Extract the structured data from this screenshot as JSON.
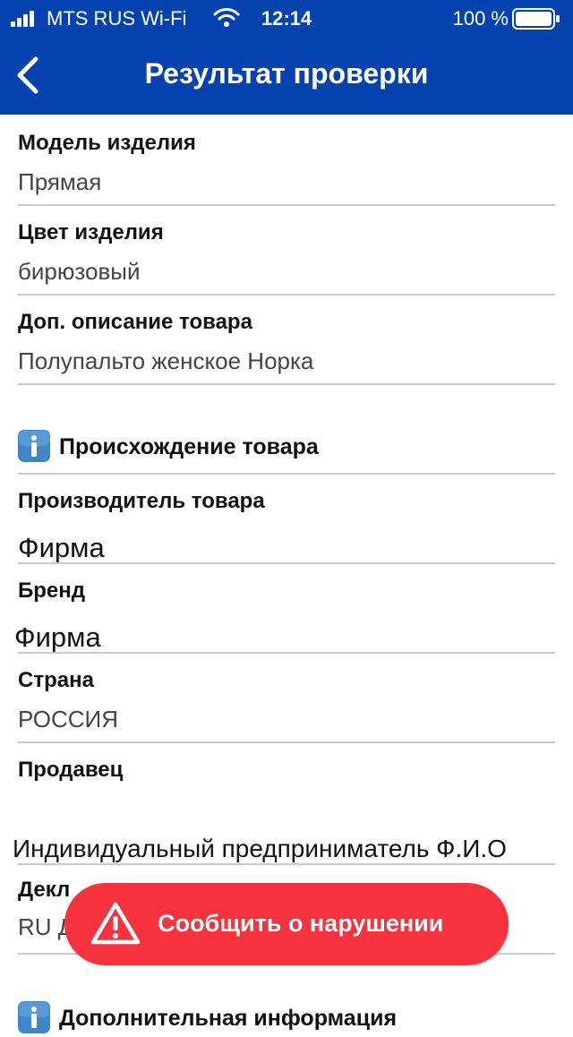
{
  "status_bar": {
    "carrier": "MTS RUS Wi-Fi",
    "time": "12:14",
    "battery": "100 %"
  },
  "header": {
    "title": "Результат проверки",
    "back_icon": "chevron-left-icon"
  },
  "product": {
    "model_label": "Модель изделия",
    "model_value": "Прямая",
    "color_label": "Цвет изделия",
    "color_value": "бирюзовый",
    "description_label": "Доп. описание товара",
    "description_value": "Полупальто женское Норка"
  },
  "origin": {
    "section_title": "Происхождение товара",
    "section_icon": "info-icon",
    "manufacturer_label": "Производитель товара",
    "manufacturer_value": "Фирма",
    "brand_label": "Бренд",
    "brand_value": "Фирма",
    "country_label": "Страна",
    "country_value": "РОССИЯ",
    "seller_label": "Продавец",
    "seller_value": "Индивидуальный предприниматель Ф.И.О",
    "declaration_label": "Декл",
    "declaration_value": "RU Д"
  },
  "additional": {
    "section_title": "Дополнительная информация",
    "section_icon": "info-icon"
  },
  "report_button": {
    "label": "Сообщить о нарушении",
    "icon": "warning-icon",
    "color": "#f6323f"
  },
  "colors": {
    "primary": "#0442b0",
    "info_icon": "#3f86c7"
  }
}
